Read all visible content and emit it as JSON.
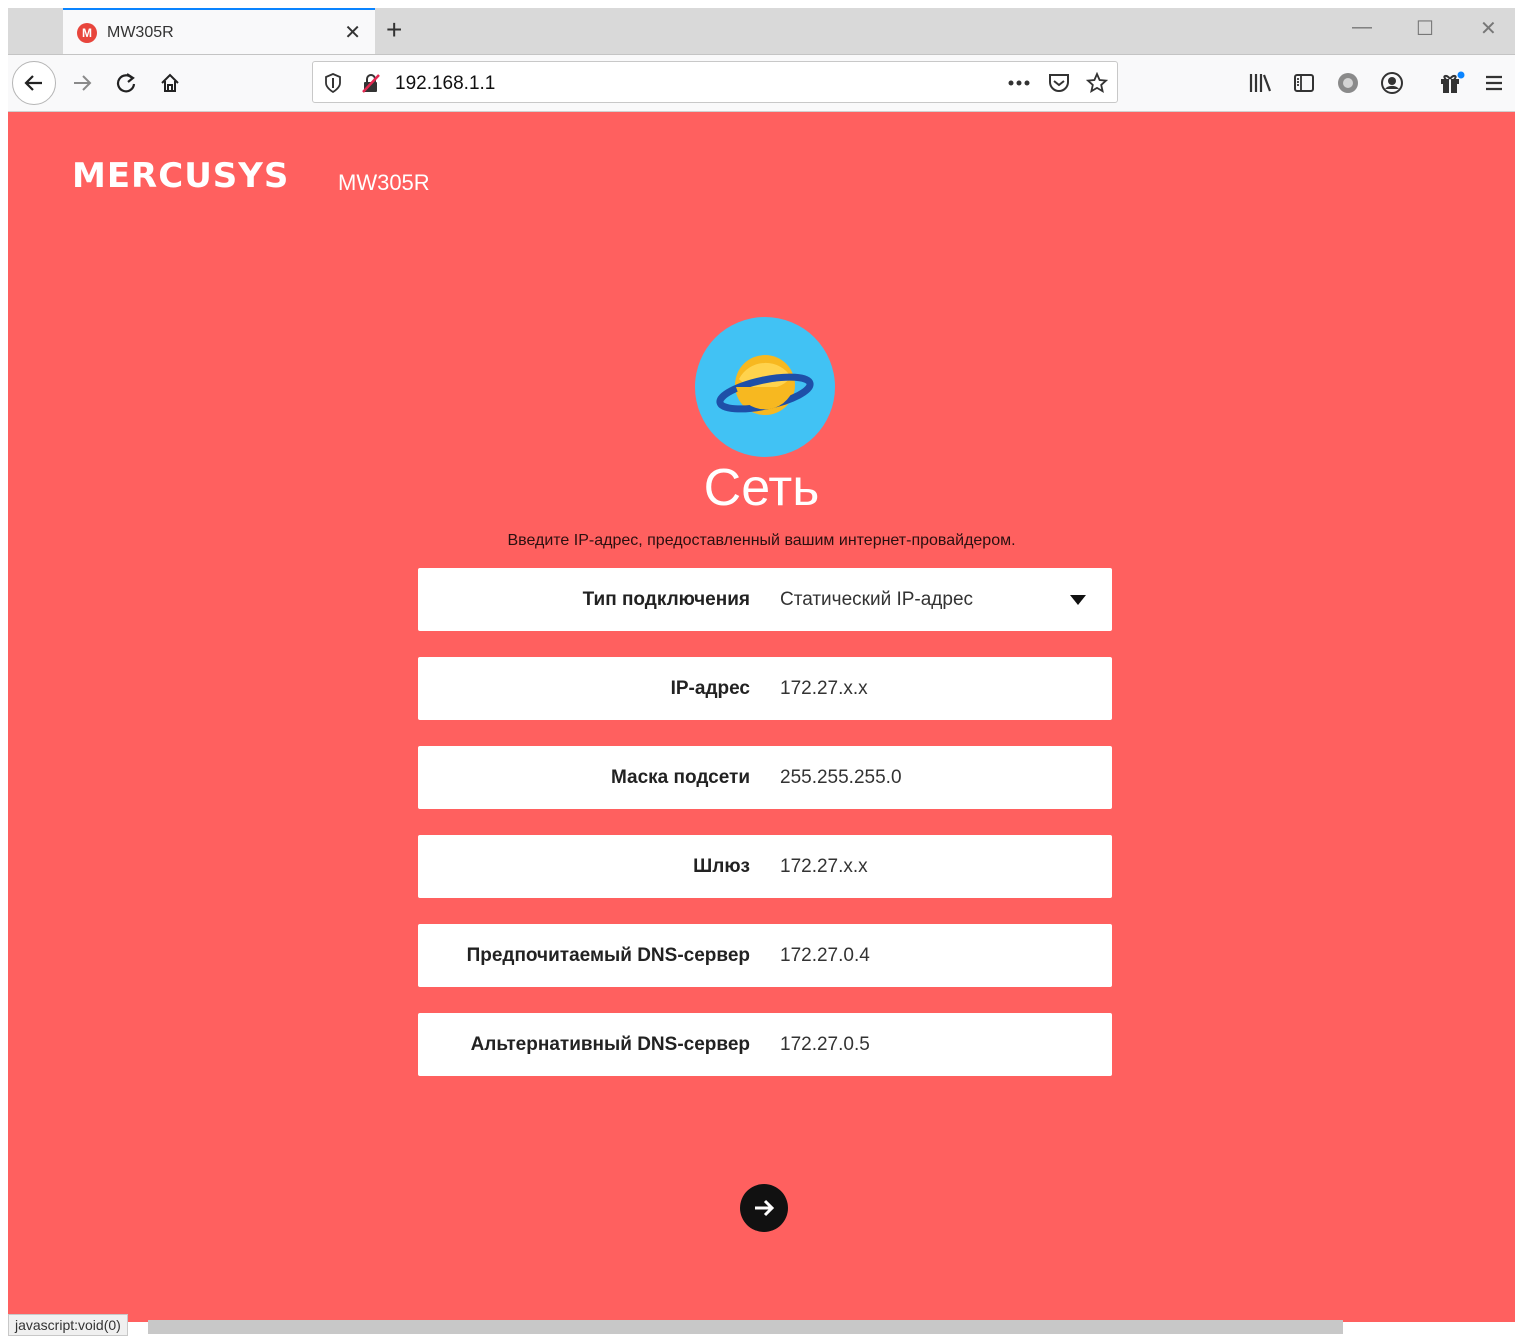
{
  "browser": {
    "tab_title": "MW305R",
    "favicon_letter": "M",
    "url": "192.168.1.1",
    "status_text": "javascript:void(0)"
  },
  "brand": {
    "logo_text": "MERCUSYS",
    "model": "MW305R"
  },
  "page": {
    "title": "Сеть",
    "subtitle": "Введите IP-адрес, предоставленный вашим интернет-провайдером."
  },
  "form": {
    "connection_type": {
      "label": "Тип подключения",
      "value": "Статический IP-адрес"
    },
    "ip_address": {
      "label": "IP-адрес",
      "value": "172.27.x.x"
    },
    "subnet_mask": {
      "label": "Маска подсети",
      "value": "255.255.255.0"
    },
    "gateway": {
      "label": "Шлюз",
      "value": "172.27.x.x"
    },
    "primary_dns": {
      "label": "Предпочитаемый DNS-сервер",
      "value": "172.27.0.4"
    },
    "secondary_dns": {
      "label": "Альтернативный DNS-сервер",
      "value": "172.27.0.5"
    }
  },
  "colors": {
    "background": "#ff605f",
    "planet_circle": "#41c2f4",
    "planet_body": "#f7b820",
    "ring": "#1e4fa8"
  }
}
